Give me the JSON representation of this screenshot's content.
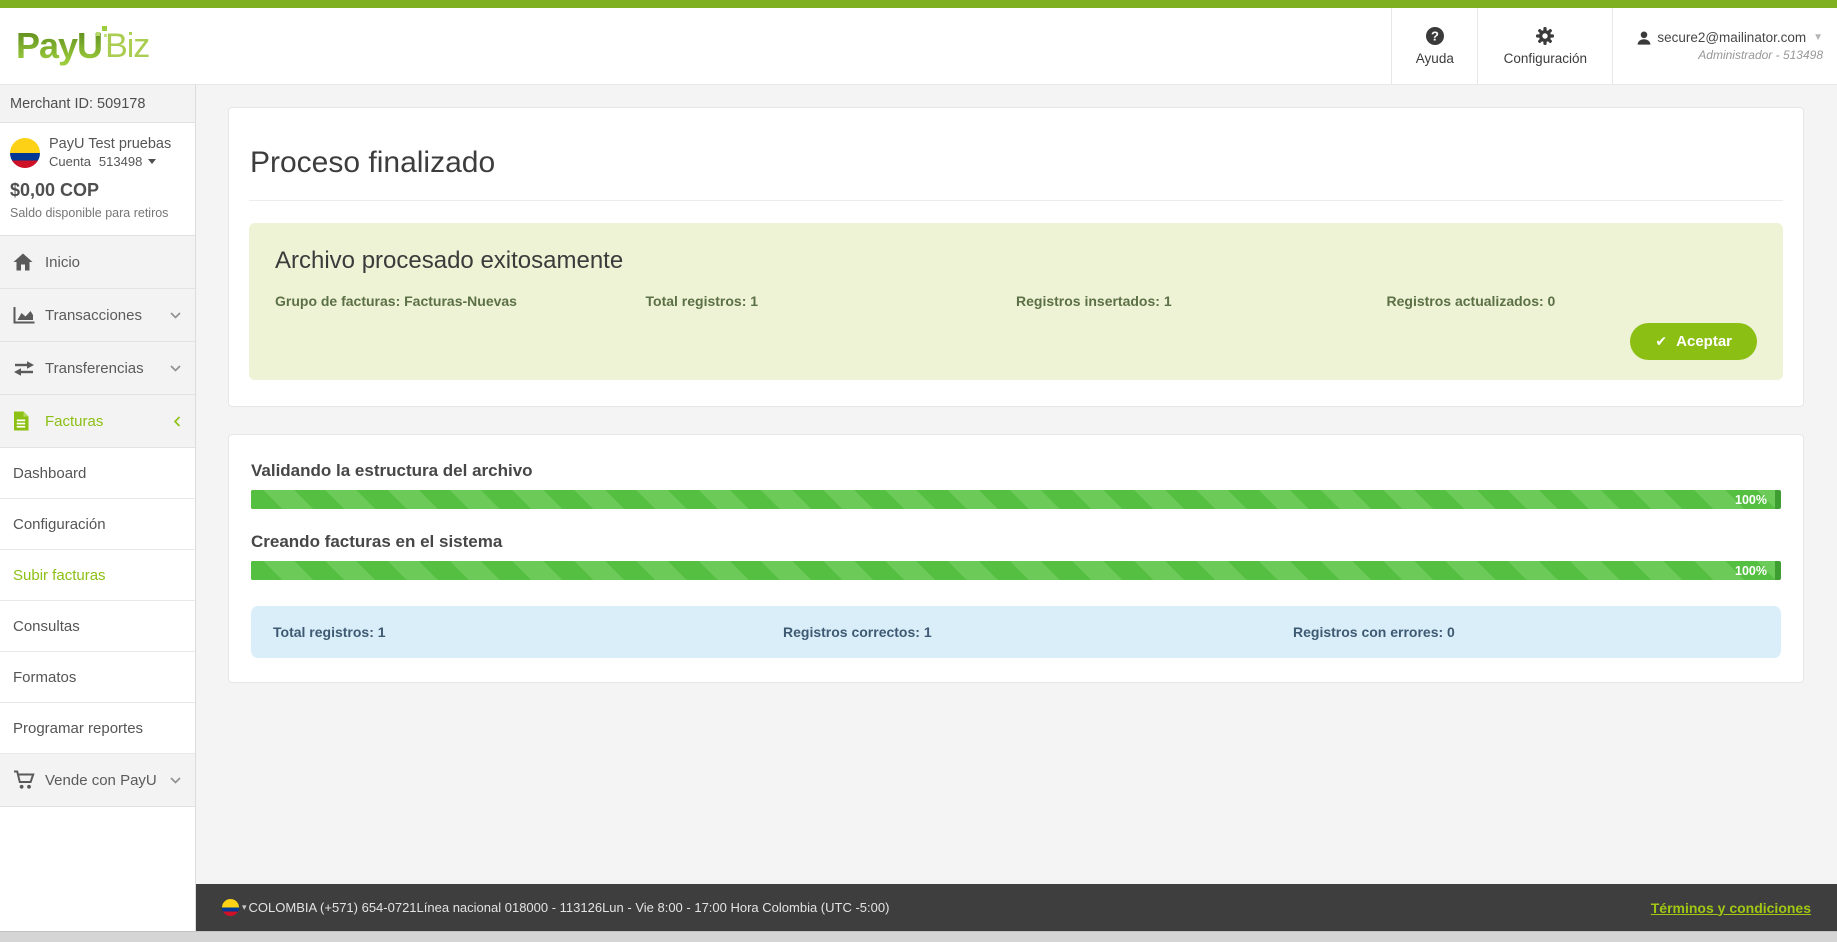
{
  "colors": {
    "accent_green": "#8cbf13",
    "topbar_green": "#7eb021",
    "progress_green": "#55bf41",
    "success_panel_bg": "#eef3d6",
    "summary_bg": "#daeefa",
    "footer_link_green": "#9fc713"
  },
  "header": {
    "brand_payu": "PayU",
    "brand_biz": "Biz",
    "help": "Ayuda",
    "settings": "Configuración",
    "user_email": "secure2@mailinator.com",
    "user_role": "Administrador - 513498"
  },
  "sidebar": {
    "merchant": "Merchant ID: 509178",
    "account_name": "PayU Test pruebas",
    "account_prefix": "Cuenta",
    "account_number": "513498",
    "balance": "$0,00 COP",
    "balance_caption": "Saldo disponible para retiros",
    "items": [
      {
        "label": "Inicio",
        "icon": "home-icon"
      },
      {
        "label": "Transacciones",
        "icon": "chart-icon",
        "chevron": "down"
      },
      {
        "label": "Transferencias",
        "icon": "transfer-icon",
        "chevron": "down"
      },
      {
        "label": "Facturas",
        "icon": "invoice-icon",
        "chevron": "left",
        "active": true
      },
      {
        "label": "Dashboard",
        "sub": true
      },
      {
        "label": "Configuración",
        "sub": true
      },
      {
        "label": "Subir facturas",
        "sub": true,
        "active": true
      },
      {
        "label": "Consultas",
        "sub": true
      },
      {
        "label": "Formatos",
        "sub": true
      },
      {
        "label": "Programar reportes",
        "sub": true
      },
      {
        "label": "Vende con PayU",
        "icon": "cart-icon",
        "chevron": "down"
      }
    ]
  },
  "main": {
    "title": "Proceso finalizado",
    "success": {
      "title": "Archivo procesado exitosamente",
      "stats": [
        "Grupo de facturas: Facturas-Nuevas",
        "Total registros: 1",
        "Registros insertados: 1",
        "Registros actualizados: 0"
      ],
      "accept": "Aceptar"
    },
    "progress": [
      {
        "label": "Validando la estructura del archivo",
        "value": "100%"
      },
      {
        "label": "Creando facturas en el sistema",
        "value": "100%"
      }
    ],
    "summary": [
      "Total registros: 1",
      "Registros correctos: 1",
      "Registros con errores: 0"
    ]
  },
  "footer": {
    "phone": "COLOMBIA (+571) 654-0721",
    "line": "Línea nacional 018000 - 113126",
    "hours": "Lun - Vie 8:00 - 17:00 Hora Colombia (UTC -5:00)",
    "terms": "Términos y condiciones"
  }
}
